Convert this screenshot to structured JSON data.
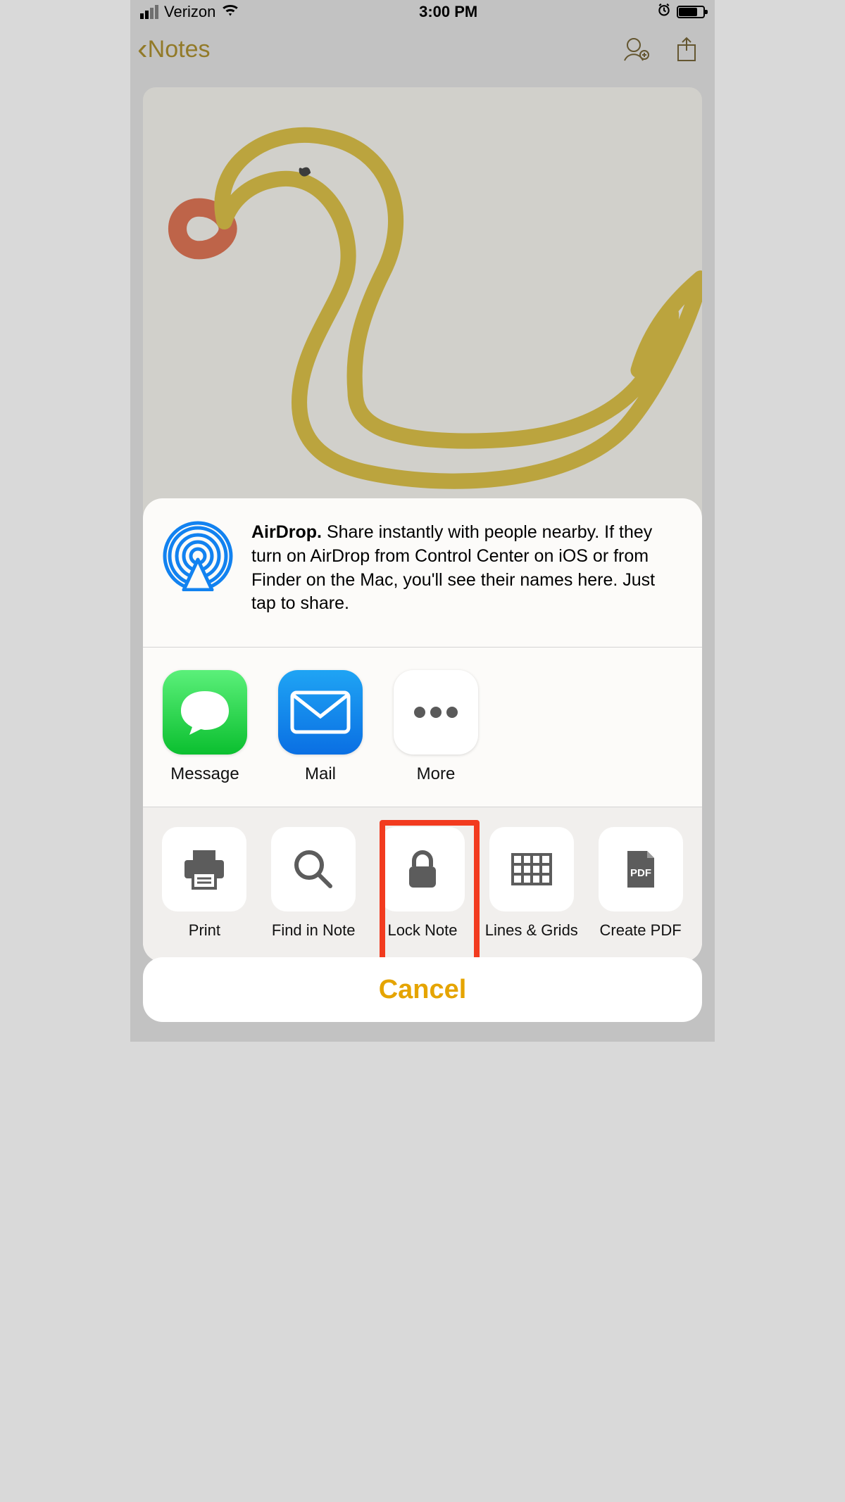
{
  "status_bar": {
    "carrier": "Verizon",
    "time": "3:00 PM"
  },
  "nav": {
    "back_label": "Notes"
  },
  "share_sheet": {
    "airdrop": {
      "title": "AirDrop.",
      "description": " Share instantly with people nearby. If they turn on AirDrop from Control Center on iOS or from Finder on the Mac, you'll see their names here. Just tap to share."
    },
    "apps": [
      {
        "label": "Message"
      },
      {
        "label": "Mail"
      },
      {
        "label": "More"
      }
    ],
    "actions": [
      {
        "label": "Print"
      },
      {
        "label": "Find in Note"
      },
      {
        "label": "Lock Note"
      },
      {
        "label": "Lines & Grids"
      },
      {
        "label": "Create PDF"
      }
    ],
    "cancel_label": "Cancel"
  },
  "highlight": {
    "target_action_index": 2
  }
}
